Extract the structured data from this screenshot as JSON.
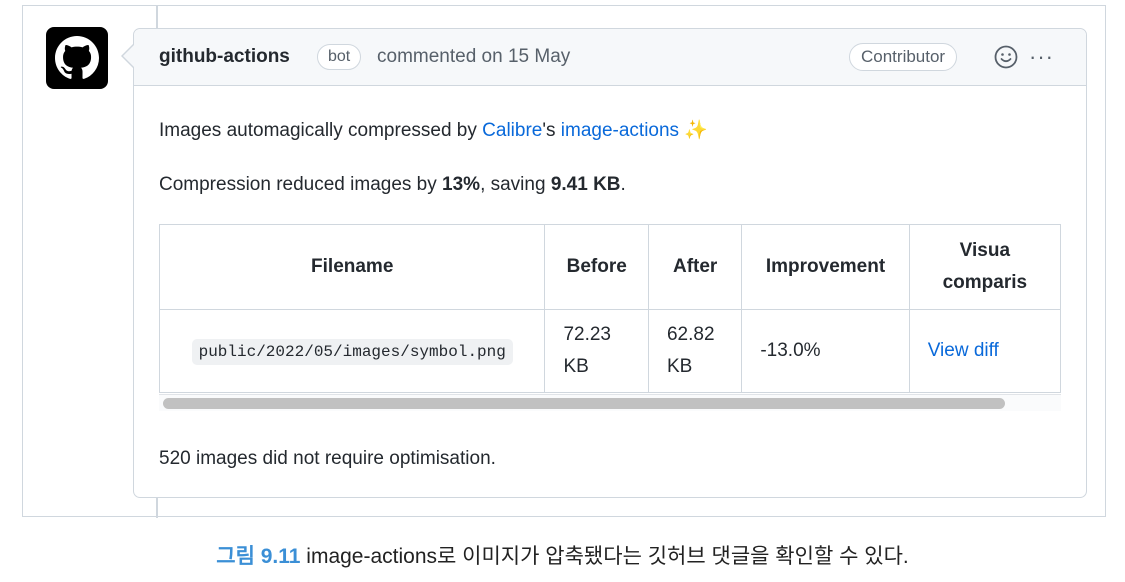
{
  "comment": {
    "author": "github-actions",
    "bot_badge": "bot",
    "commented_text": "commented on 15 May",
    "role_badge": "Contributor",
    "icons": [
      "github-mark-icon",
      "smiley-icon",
      "kebab-menu-icon"
    ],
    "body": {
      "intro_prefix": "Images automagically compressed by ",
      "calibre_link": "Calibre",
      "intro_mid": "'s ",
      "image_actions_link": "image-actions",
      "sparkle": "✨",
      "compression_prefix": "Compression reduced images by ",
      "compression_percent": "13%",
      "compression_mid": ", saving ",
      "compression_saving": "9.41 KB",
      "compression_suffix": ".",
      "table": {
        "headers": [
          "Filename",
          "Before",
          "After",
          "Improvement",
          "Visual comparison"
        ],
        "header_visual_line1": "Visua",
        "header_visual_line2": "comparis",
        "rows": [
          {
            "filename": "public/2022/05/images/symbol.png",
            "before_line1": "72.23",
            "before_line2": "KB",
            "after_line1": "62.82",
            "after_line2": "KB",
            "improvement": "-13.0%",
            "link": "View diff"
          }
        ]
      },
      "footer": "520 images did not require optimisation."
    }
  },
  "caption": {
    "label": "그림 9.11",
    "text": " image-actions로 이미지가 압축됐다는 깃허브 댓글을 확인할 수 있다."
  },
  "colors": {
    "link": "#0969da",
    "caption_label": "#3b8fd6",
    "border": "#d0d7de"
  }
}
